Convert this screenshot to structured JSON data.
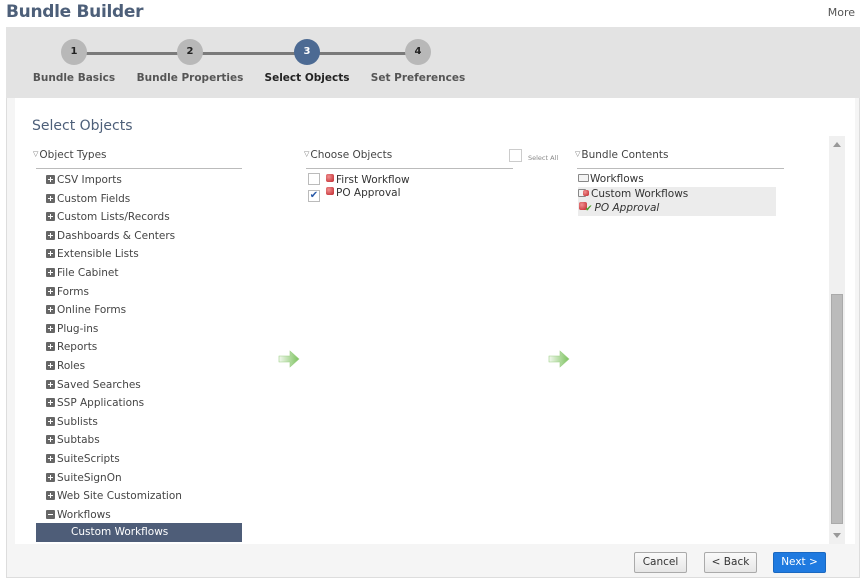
{
  "header": {
    "title": "Bundle Builder",
    "more_label": "More"
  },
  "steps": [
    {
      "number": "1",
      "label": "Bundle Basics",
      "active": false
    },
    {
      "number": "2",
      "label": "Bundle Properties",
      "active": false
    },
    {
      "number": "3",
      "label": "Select Objects",
      "active": true
    },
    {
      "number": "4",
      "label": "Set Preferences",
      "active": false
    }
  ],
  "main": {
    "section_title": "Select Objects",
    "object_types": {
      "heading": "Object Types",
      "items": [
        {
          "label": "CSV Imports",
          "expanded": false
        },
        {
          "label": "Custom Fields",
          "expanded": false
        },
        {
          "label": "Custom Lists/Records",
          "expanded": false
        },
        {
          "label": "Dashboards & Centers",
          "expanded": false
        },
        {
          "label": "Extensible Lists",
          "expanded": false
        },
        {
          "label": "File Cabinet",
          "expanded": false
        },
        {
          "label": "Forms",
          "expanded": false
        },
        {
          "label": "Online Forms",
          "expanded": false
        },
        {
          "label": "Plug-ins",
          "expanded": false
        },
        {
          "label": "Reports",
          "expanded": false
        },
        {
          "label": "Roles",
          "expanded": false
        },
        {
          "label": "Saved Searches",
          "expanded": false
        },
        {
          "label": "SSP Applications",
          "expanded": false
        },
        {
          "label": "Sublists",
          "expanded": false
        },
        {
          "label": "Subtabs",
          "expanded": false
        },
        {
          "label": "SuiteScripts",
          "expanded": false
        },
        {
          "label": "SuiteSignOn",
          "expanded": false
        },
        {
          "label": "Web Site Customization",
          "expanded": false
        },
        {
          "label": "Workflows",
          "expanded": true
        }
      ],
      "selected_child": "Custom Workflows"
    },
    "choose_objects": {
      "heading": "Choose Objects",
      "select_all_label": "Select All",
      "select_all_checked": false,
      "items": [
        {
          "label": "First Workflow",
          "checked": false
        },
        {
          "label": "PO Approval",
          "checked": true
        }
      ]
    },
    "bundle_contents": {
      "heading": "Bundle Contents",
      "items": [
        {
          "label": "Workflows",
          "icon": "folder-icon"
        },
        {
          "label": "Custom Workflows",
          "icon": "folder-object-icon"
        },
        {
          "label": "PO Approval",
          "icon": "object-check-icon"
        }
      ]
    }
  },
  "footer": {
    "cancel_label": "Cancel",
    "back_label": "< Back",
    "next_label": "Next >"
  },
  "colors": {
    "accent": "#4c6a93",
    "primary_button": "#1f7ae0",
    "selected_row": "#4e5d78"
  }
}
